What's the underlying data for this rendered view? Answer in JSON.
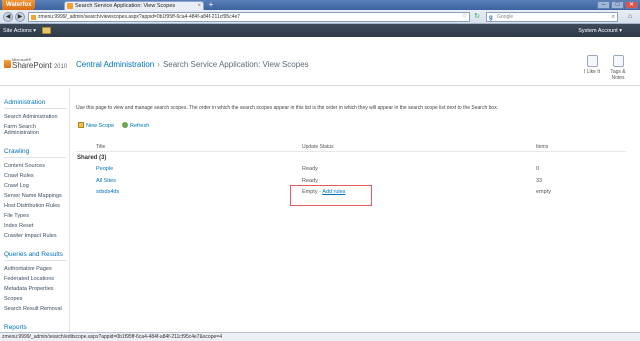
{
  "browser": {
    "menu_label": "Waterfox",
    "tab_title": "Search Service Application: View Scopes",
    "tab_close": "×",
    "new_tab": "+",
    "url": "zmenu:9999/_admin/search/viewscopes.aspx?appid=0b1f95ff-6ca4-484f-a84f-211cf95c4e7",
    "search_engine_icon": "g",
    "search_placeholder": "Google",
    "search_icon_glyph": "⌕",
    "back_glyph": "◀",
    "forward_glyph": "▶",
    "reload_glyph": "↻",
    "home_glyph": "⌂",
    "star_glyph": "☆",
    "minimize": "–",
    "maximize": "□",
    "close": "✕"
  },
  "ribbon": {
    "site_actions": "Site Actions ▾",
    "system_account": "System Account ▾"
  },
  "header": {
    "logo_ms": "Microsoft®",
    "logo_sp": "SharePoint",
    "logo_ver": "2010",
    "breadcrumb_root": "Central Administration",
    "breadcrumb_sep": "›",
    "breadcrumb_page": "Search Service Application: View Scopes",
    "like_label": "I Like It",
    "tags_label": "Tags & Notes"
  },
  "left_nav": {
    "groups": [
      {
        "title": "Administration",
        "items": [
          "Search Administration",
          "Farm Search Administration"
        ]
      },
      {
        "title": "Crawling",
        "items": [
          "Content Sources",
          "Crawl Rules",
          "Crawl Log",
          "Server Name Mappings",
          "Host Distribution Rules",
          "File Types",
          "Index Reset",
          "Crawler Impact Rules"
        ]
      },
      {
        "title": "Queries and Results",
        "items": [
          "Authoritative Pages",
          "Federated Locations",
          "Metadata Properties",
          "Scopes",
          "Search Result Removal"
        ]
      },
      {
        "title": "Reports",
        "items": []
      }
    ]
  },
  "main": {
    "intro": "Use this page to view and manage search scopes. The order in which the search scopes appear in this list is the order in which they will appear in the search scope list next to the Search box.",
    "toolbar": {
      "new_scope": "New Scope",
      "refresh": "Refresh"
    },
    "columns": {
      "title": "Title",
      "status": "Update Status",
      "items": "Items"
    },
    "group": "Shared (3)",
    "rows": [
      {
        "title": "People",
        "status": "Ready",
        "items": "0"
      },
      {
        "title": "All Sites",
        "status": "Ready",
        "items": "33"
      },
      {
        "title": "sdsds4ds",
        "status": "Empty -",
        "link": "Add rules",
        "items": "empty"
      }
    ]
  },
  "status_bar": "zmenu:9999/_admin/search/editscope.aspx?appid=0b1f95ff-6ca4-484f-a84f-211cf95c4e7&scope=4"
}
